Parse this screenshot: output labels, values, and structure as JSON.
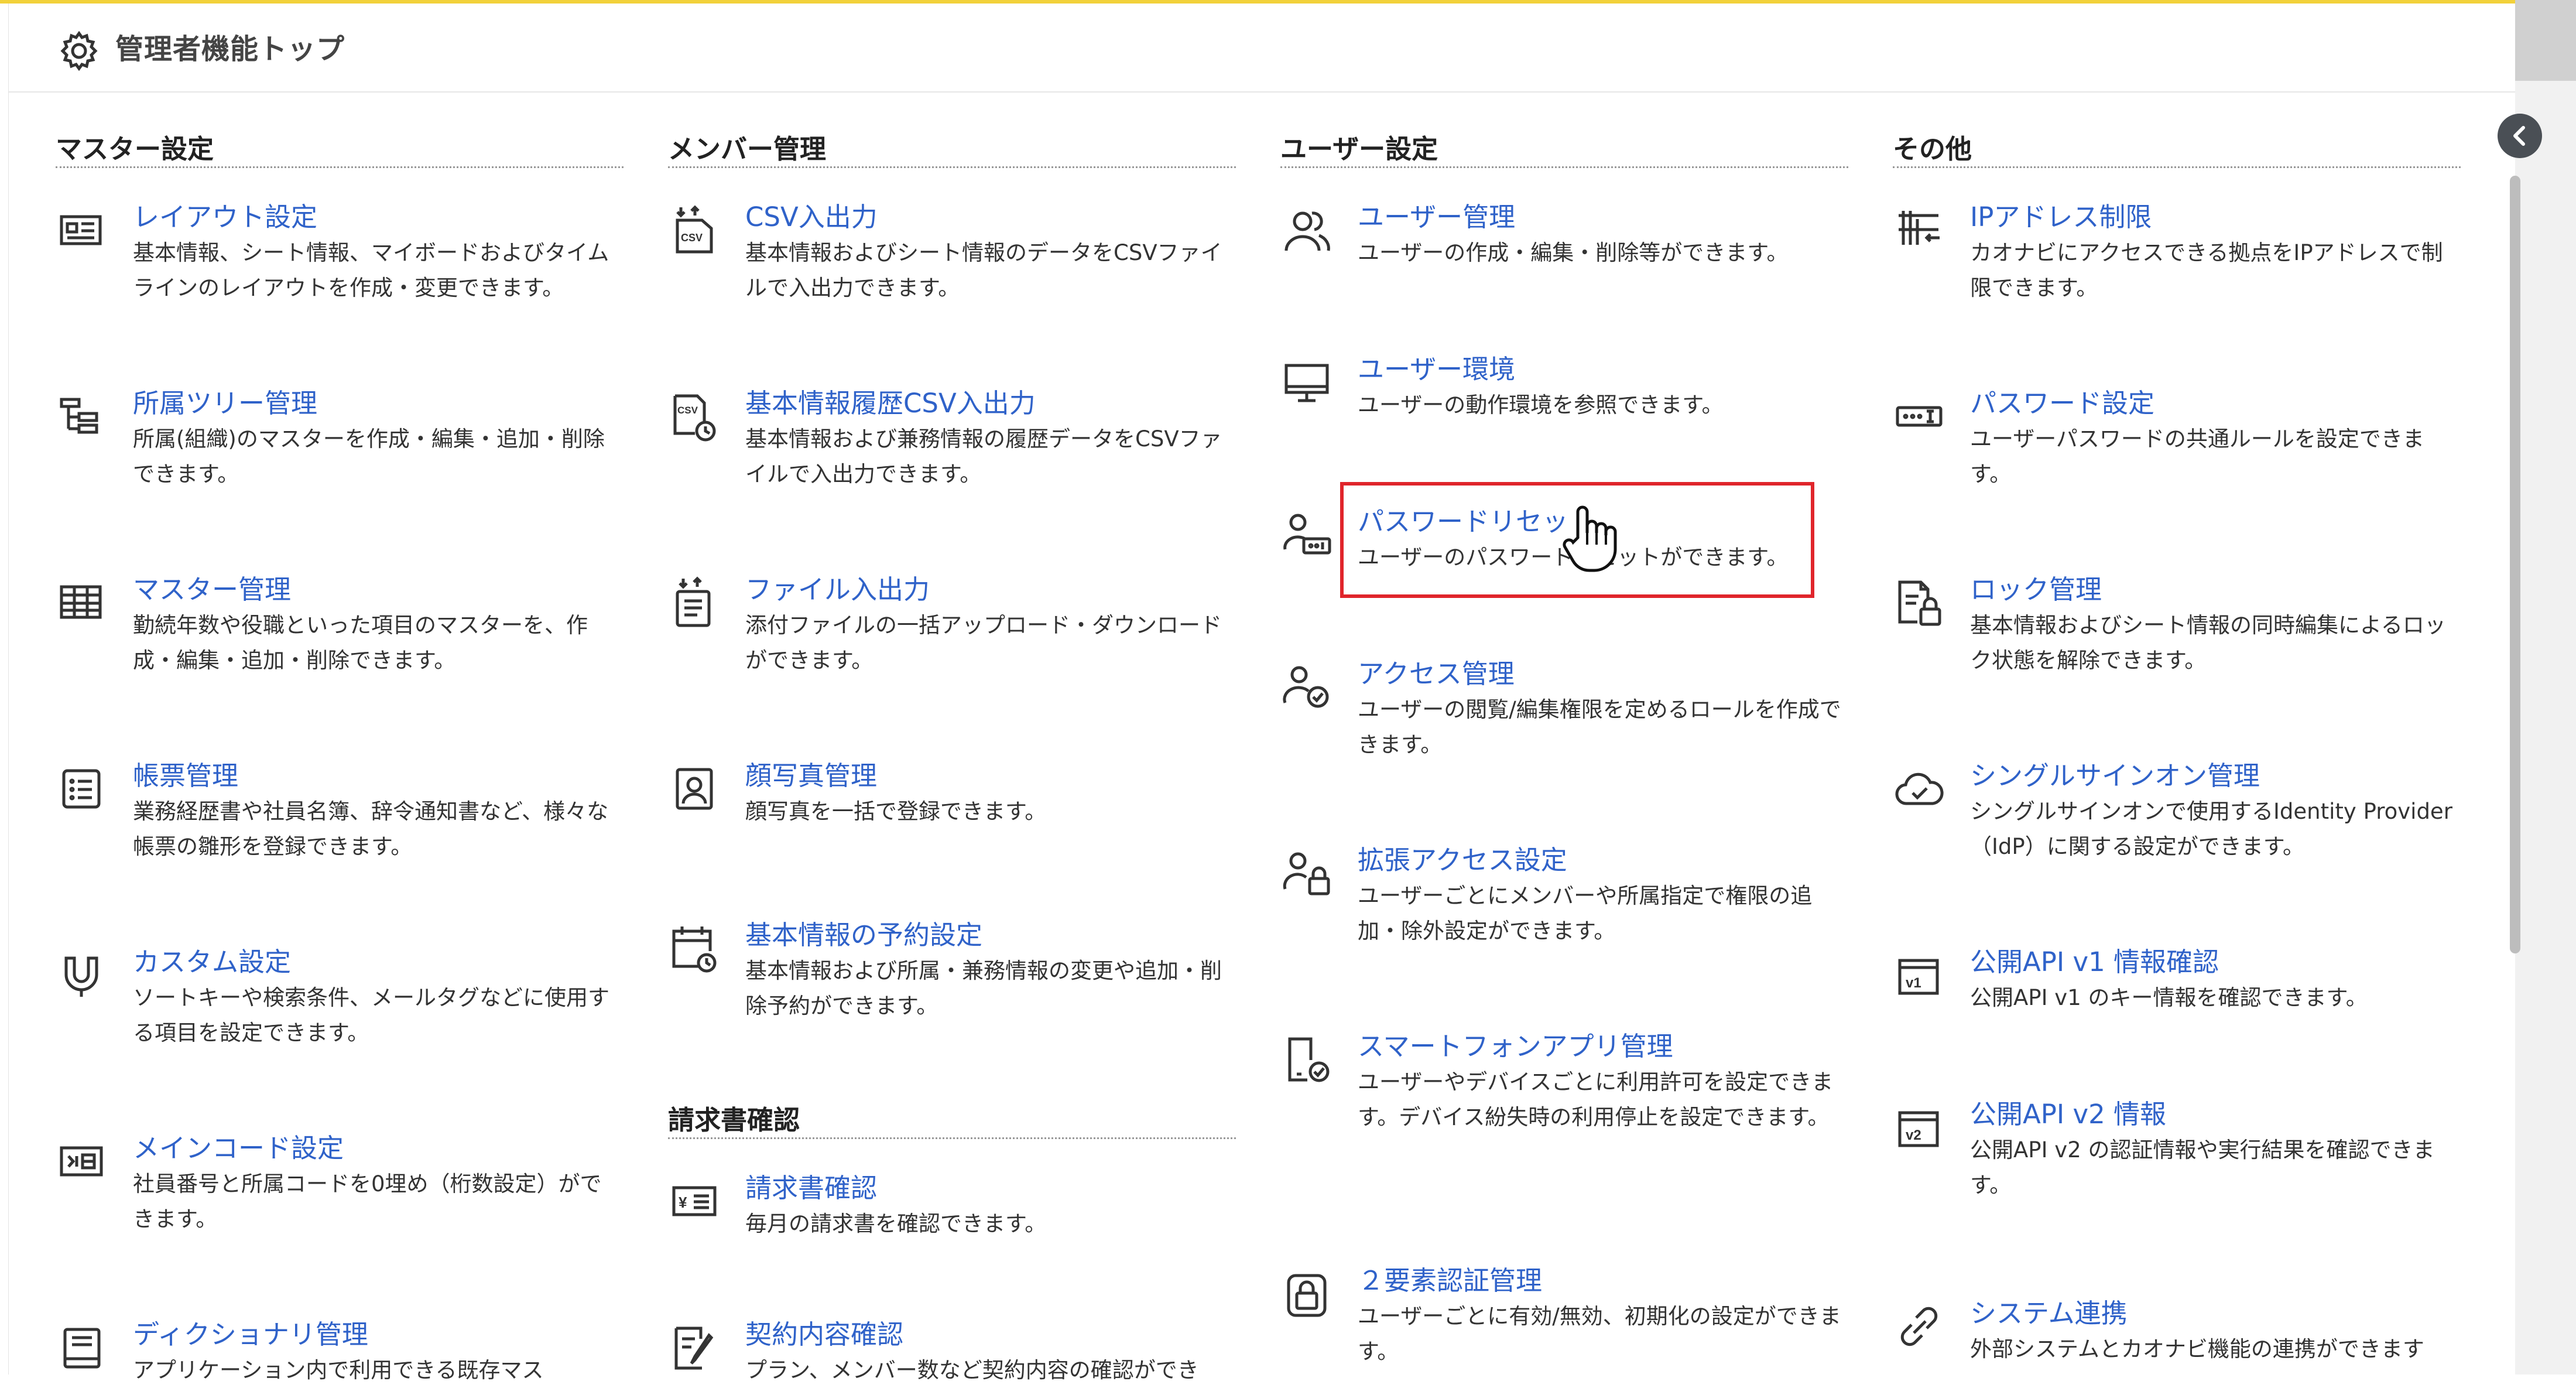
{
  "header": {
    "title": "管理者機能トップ",
    "icon": "gear-icon"
  },
  "columns": [
    {
      "title": "マスター設定",
      "items": [
        {
          "name": "レイアウト設定",
          "desc": "基本情報、シート情報、マイボードおよびタイムラインのレイアウトを作成・変更できます。",
          "icon": "layout-icon"
        },
        {
          "name": "所属ツリー管理",
          "desc": "所属(組織)のマスターを作成・編集・追加・削除できます。",
          "icon": "tree-icon"
        },
        {
          "name": "マスター管理",
          "desc": "勤続年数や役職といった項目のマスターを、作成・編集・追加・削除できます。",
          "icon": "table-icon"
        },
        {
          "name": "帳票管理",
          "desc": "業務経歴書や社員名簿、辞令通知書など、様々な帳票の雛形を登録できます。",
          "icon": "list-icon"
        },
        {
          "name": "カスタム設定",
          "desc": "ソートキーや検索条件、メールタグなどに使用する項目を設定できます。",
          "icon": "magnet-icon"
        },
        {
          "name": "メインコード設定",
          "desc": "社員番号と所属コードを0埋め（桁数設定）ができます。",
          "icon": "code-icon"
        },
        {
          "name": "ディクショナリ管理",
          "desc": "アプリケーション内で利用できる既存マス",
          "icon": "book-icon"
        }
      ]
    },
    {
      "title": "メンバー管理",
      "items": [
        {
          "name": "CSV入出力",
          "desc": "基本情報およびシート情報のデータをCSVファイルで入出力できます。",
          "icon": "csv-icon"
        },
        {
          "name": "基本情報履歴CSV入出力",
          "desc": "基本情報および兼務情報の履歴データをCSVファイルで入出力できます。",
          "icon": "csv-history-icon"
        },
        {
          "name": "ファイル入出力",
          "desc": "添付ファイルの一括アップロード・ダウンロードができます。",
          "icon": "file-transfer-icon"
        },
        {
          "name": "顔写真管理",
          "desc": "顔写真を一括で登録できます。",
          "icon": "portrait-icon"
        },
        {
          "name": "基本情報の予約設定",
          "desc": "基本情報および所属・兼務情報の変更や追加・削除予約ができます。",
          "icon": "calendar-clock-icon"
        }
      ],
      "section2_title": "請求書確認",
      "items2": [
        {
          "name": "請求書確認",
          "desc": "毎月の請求書を確認できます。",
          "icon": "invoice-icon"
        },
        {
          "name": "契約内容確認",
          "desc": "プラン、メンバー数など契約内容の確認ができ",
          "icon": "contract-icon"
        }
      ]
    },
    {
      "title": "ユーザー設定",
      "items": [
        {
          "name": "ユーザー管理",
          "desc": "ユーザーの作成・編集・削除等ができます。",
          "icon": "users-icon"
        },
        {
          "name": "ユーザー環境",
          "desc": "ユーザーの動作環境を参照できます。",
          "icon": "monitor-icon"
        },
        {
          "name": "パスワードリセット",
          "desc": "ユーザーのパスワードリセットができます。",
          "icon": "user-password-icon"
        },
        {
          "name": "アクセス管理",
          "desc": "ユーザーの閲覧/編集権限を定めるロールを作成できます。",
          "icon": "user-check-icon"
        },
        {
          "name": "拡張アクセス設定",
          "desc": "ユーザーごとにメンバーや所属指定で権限の追加・除外設定ができます。",
          "icon": "user-lock-icon"
        },
        {
          "name": "スマートフォンアプリ管理",
          "desc": "ユーザーやデバイスごとに利用許可を設定できます。デバイス紛失時の利用停止を設定できます。",
          "icon": "smartphone-icon"
        },
        {
          "name": "２要素認証管理",
          "desc": "ユーザーごとに有効/無効、初期化の設定ができます。",
          "icon": "two-factor-icon"
        }
      ]
    },
    {
      "title": "その他",
      "items": [
        {
          "name": "IPアドレス制限",
          "desc": "カオナビにアクセスできる拠点をIPアドレスで制限できます。",
          "icon": "ip-filter-icon"
        },
        {
          "name": "パスワード設定",
          "desc": "ユーザーパスワードの共通ルールを設定できます。",
          "icon": "password-field-icon"
        },
        {
          "name": "ロック管理",
          "desc": "基本情報およびシート情報の同時編集によるロック状態を解除できます。",
          "icon": "file-lock-icon"
        },
        {
          "name": "シングルサインオン管理",
          "desc": "シングルサインオンで使用するIdentity Provider（IdP）に関する設定ができます。",
          "icon": "cloud-check-icon"
        },
        {
          "name": "公開API v1 情報確認",
          "desc": "公開API v1 のキー情報を確認できます。",
          "icon": "api-v1-icon"
        },
        {
          "name": "公開API v2 情報",
          "desc": "公開API v2 の認証情報や実行結果を確認できます。",
          "icon": "api-v2-icon"
        },
        {
          "name": "システム連携",
          "desc": "外部システムとカオナビ機能の連携ができます",
          "icon": "link-icon"
        }
      ]
    }
  ],
  "colors": {
    "accent": "#2f62c9",
    "highlight": "#e0252b",
    "topline": "#f2d13a"
  }
}
